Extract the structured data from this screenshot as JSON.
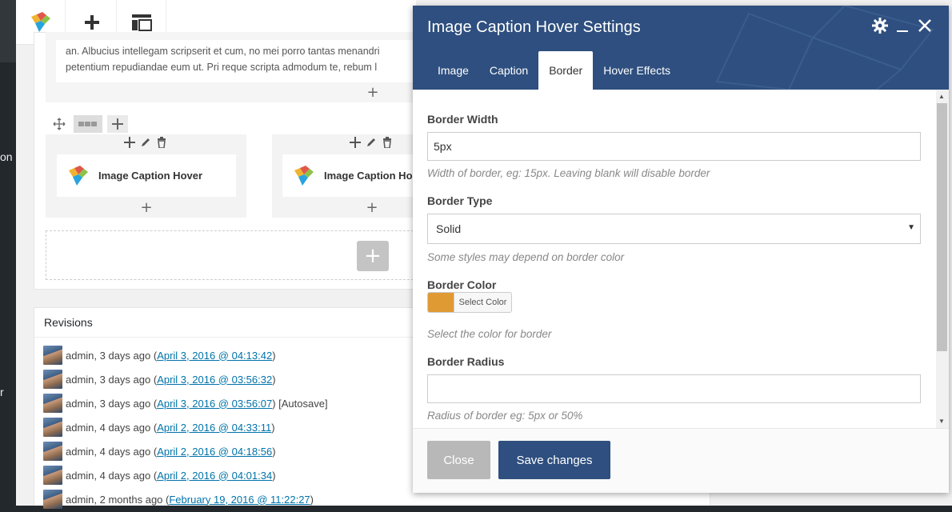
{
  "sidebar_fragments": [
    "on",
    "r"
  ],
  "toolbar": {
    "add_icon": "plus-icon",
    "layout_icon": "layout-icon"
  },
  "composer": {
    "text_line1": "an. Albucius intellegam scripserit et cum, no mei porro tantas menandri",
    "text_line2": "petentium repudiandae eum ut. Pri reque scripta admodum te, rebum l",
    "plus": "+",
    "element_label_1": "Image Caption Hover",
    "element_label_2": "Image Caption Ho",
    "add_icon": "+"
  },
  "revisions": {
    "title": "Revisions",
    "items": [
      {
        "who": "admin, 3 days ago (",
        "link": "April 3, 2016 @ 04:13:42",
        "tail": ")"
      },
      {
        "who": "admin, 3 days ago (",
        "link": "April 3, 2016 @ 03:56:32",
        "tail": ")"
      },
      {
        "who": "admin, 3 days ago (",
        "link": "April 3, 2016 @ 03:56:07",
        "tail": ") [Autosave]"
      },
      {
        "who": "admin, 4 days ago (",
        "link": "April 2, 2016 @ 04:33:11",
        "tail": ")"
      },
      {
        "who": "admin, 4 days ago (",
        "link": "April 2, 2016 @ 04:18:56",
        "tail": ")"
      },
      {
        "who": "admin, 4 days ago (",
        "link": "April 2, 2016 @ 04:01:34",
        "tail": ")"
      },
      {
        "who": "admin, 2 months ago (",
        "link": "February 19, 2016 @ 11:22:27",
        "tail": ")"
      }
    ]
  },
  "modal": {
    "title": "Image Caption Hover Settings",
    "tabs": [
      "Image",
      "Caption",
      "Border",
      "Hover Effects"
    ],
    "active_tab": "Border",
    "fields": {
      "border_width": {
        "label": "Border Width",
        "value": "5px",
        "help": "Width of border, eg: 15px. Leaving blank will disable border"
      },
      "border_type": {
        "label": "Border Type",
        "value": "Solid",
        "help": "Some styles may depend on border color"
      },
      "border_color": {
        "label": "Border Color",
        "button": "Select Color",
        "color": "#e09a34",
        "help": "Select the color for border"
      },
      "border_radius": {
        "label": "Border Radius",
        "value": "",
        "help": "Radius of border eg: 5px or 50%"
      }
    },
    "close_label": "Close",
    "save_label": "Save changes"
  },
  "colors": {
    "header": "#2e4f7f",
    "accent": "#2e4f7f",
    "swatch": "#e09a34"
  }
}
